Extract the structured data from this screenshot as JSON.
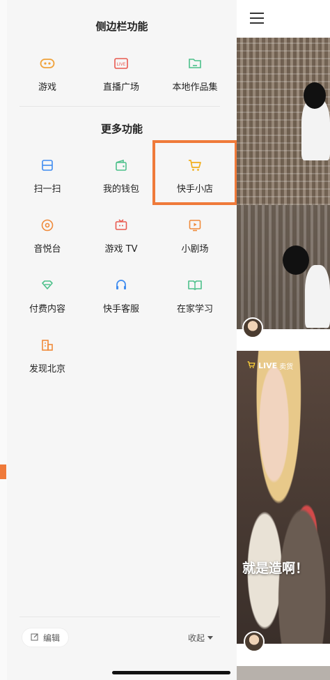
{
  "drawer": {
    "section_sidebar_title": "侧边栏功能",
    "sidebar_items": [
      {
        "label": "游戏",
        "icon": "gamepad-icon",
        "color": "#f0a23a"
      },
      {
        "label": "直播广场",
        "icon": "live-icon",
        "color": "#e9594f"
      },
      {
        "label": "本地作品集",
        "icon": "folder-icon",
        "color": "#4cc08a"
      }
    ],
    "section_more_title": "更多功能",
    "more_items": [
      {
        "label": "扫一扫",
        "icon": "scan-icon",
        "color": "#3f8cf0"
      },
      {
        "label": "我的钱包",
        "icon": "wallet-icon",
        "color": "#4cc08a"
      },
      {
        "label": "快手小店",
        "icon": "cart-icon",
        "color": "#f2b01e"
      },
      {
        "label": "音悦台",
        "icon": "music-disc-icon",
        "color": "#f08a3a"
      },
      {
        "label": "游戏 TV",
        "icon": "tv-icon",
        "color": "#e9594f"
      },
      {
        "label": "小剧场",
        "icon": "play-screen-icon",
        "color": "#f08a3a"
      },
      {
        "label": "付费内容",
        "icon": "diamond-icon",
        "color": "#4cc08a"
      },
      {
        "label": "快手客服",
        "icon": "headset-icon",
        "color": "#3f8cf0"
      },
      {
        "label": "在家学习",
        "icon": "book-icon",
        "color": "#4cc08a"
      },
      {
        "label": "发现北京",
        "icon": "city-icon",
        "color": "#f08a3a"
      }
    ],
    "edit_label": "编辑",
    "collapse_label": "收起"
  },
  "feed": {
    "live_label": "LIVE",
    "sell_label": "卖货",
    "caption": "就是造啊！"
  },
  "colors": {
    "highlight": "#ef7a3a"
  }
}
